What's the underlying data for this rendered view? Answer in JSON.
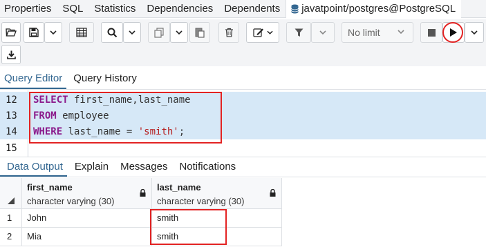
{
  "top_tabs": [
    "Properties",
    "SQL",
    "Statistics",
    "Dependencies",
    "Dependents"
  ],
  "connection_tab": {
    "label": "javatpoint/postgres@PostgreSQL",
    "icon": "database-icon"
  },
  "toolbar": {
    "limit_value": "No limit",
    "icons": [
      "open-folder-icon",
      "save-icon",
      "chevron-down-icon",
      "grid-icon",
      "search-icon",
      "copy-icon",
      "paste-icon",
      "trash-icon",
      "edit-icon",
      "filter-icon",
      "stop-icon",
      "play-icon",
      "download-icon"
    ]
  },
  "editor_tabs": {
    "active": "Query Editor",
    "other": "Query History"
  },
  "editor": {
    "lines": [
      {
        "no": "12",
        "kw": "SELECT",
        "rest": " first_name,last_name"
      },
      {
        "no": "13",
        "kw": "FROM",
        "rest": " employee"
      },
      {
        "no": "14",
        "kw": "WHERE",
        "rest": " last_name = ",
        "str": "'smith'",
        "end": ";"
      },
      {
        "no": "15"
      }
    ]
  },
  "output_tabs": [
    "Data Output",
    "Explain",
    "Messages",
    "Notifications"
  ],
  "results": {
    "columns": [
      {
        "name": "first_name",
        "type": "character varying (30)"
      },
      {
        "name": "last_name",
        "type": "character varying (30)"
      }
    ],
    "rows": [
      {
        "num": "1",
        "first_name": "John",
        "last_name": "smith"
      },
      {
        "num": "2",
        "first_name": "Mia",
        "last_name": "smith"
      }
    ]
  },
  "colors": {
    "accent": "#326690",
    "highlight": "#d6e8f7",
    "annotation": "#e32222",
    "keyword": "#8b1a8b",
    "string": "#b51d1d"
  }
}
